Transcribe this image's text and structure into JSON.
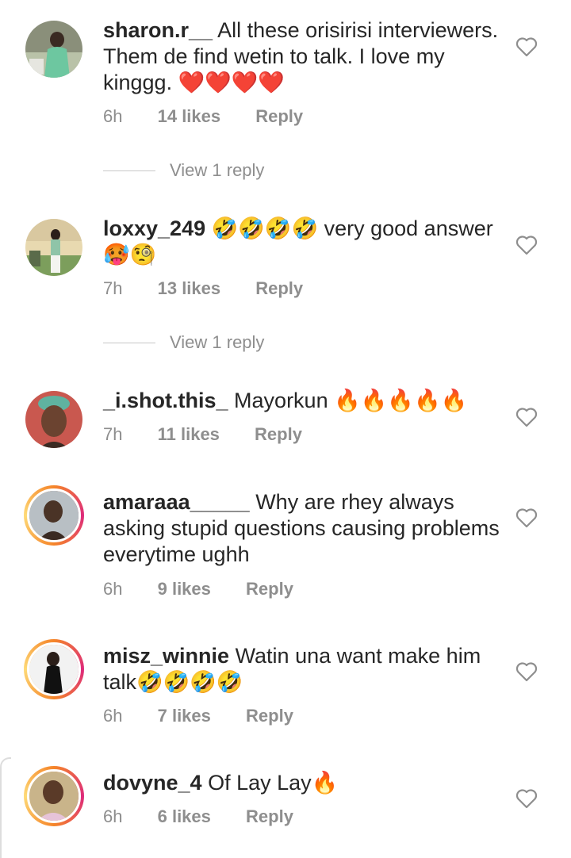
{
  "comments": [
    {
      "username": "sharon.r__",
      "text": "All these orisirisi interviewers. Them de find wetin to talk. I love my kinggg. ❤️❤️❤️❤️",
      "time": "6h",
      "likes": "14 likes",
      "reply": "Reply",
      "view_replies": "View 1 reply",
      "story_ring": false
    },
    {
      "username": "loxxy_249",
      "text": "🤣🤣🤣🤣 very good answer 🥵🧐",
      "time": "7h",
      "likes": "13 likes",
      "reply": "Reply",
      "view_replies": "View 1 reply",
      "story_ring": false
    },
    {
      "username": "_i.shot.this_",
      "text": "Mayorkun 🔥🔥🔥🔥🔥",
      "time": "7h",
      "likes": "11 likes",
      "reply": "Reply",
      "story_ring": false
    },
    {
      "username": "amaraaa_____",
      "text": "Why are rhey always asking stupid questions causing problems everytime ughh",
      "time": "6h",
      "likes": "9 likes",
      "reply": "Reply",
      "story_ring": true
    },
    {
      "username": "misz_winnie",
      "text": "Watin una want make him talk🤣🤣🤣🤣",
      "time": "6h",
      "likes": "7 likes",
      "reply": "Reply",
      "story_ring": true
    },
    {
      "username": "dovyne_4",
      "text": "Of Lay Lay🔥",
      "time": "6h",
      "likes": "6 likes",
      "reply": "Reply",
      "story_ring": true
    }
  ],
  "icons": {
    "like": "heart-outline-icon"
  },
  "colors": {
    "meta": "#8e8e8e",
    "text": "#262626",
    "ring_start": "#f58529",
    "ring_end": "#dd2a7b"
  }
}
